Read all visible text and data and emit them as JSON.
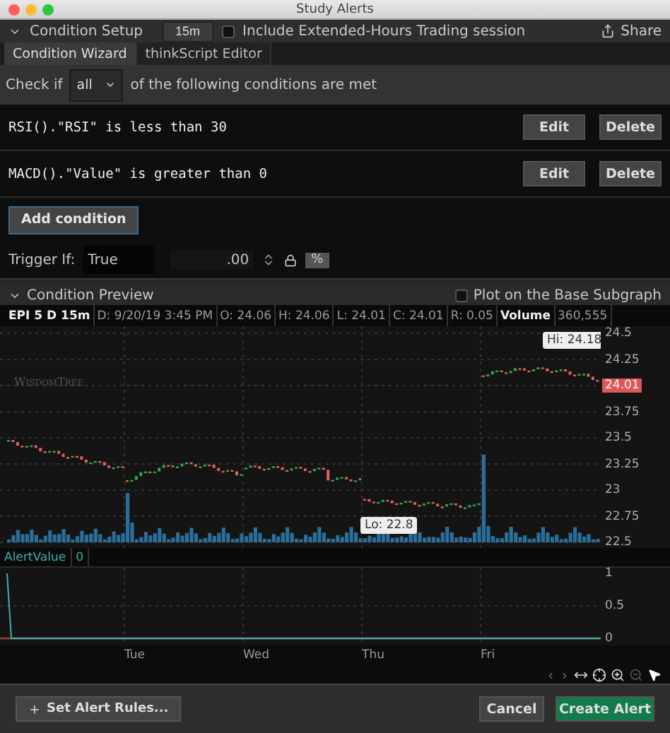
{
  "window": {
    "title": "Study Alerts"
  },
  "condition_setup": {
    "label": "Condition Setup",
    "expanded": true,
    "aggregation": "15m",
    "extended_hours": {
      "label": "Include Extended-Hours Trading session",
      "checked": false
    },
    "share": "Share"
  },
  "tabs": [
    {
      "label": "Condition Wizard",
      "selected": true
    },
    {
      "label": "thinkScript Editor",
      "selected": false
    }
  ],
  "check_if": {
    "prefix": "Check if",
    "value": "all",
    "suffix": "of the following conditions are met"
  },
  "conditions": [
    {
      "text": "RSI().\"RSI\" is less than 30",
      "edit": "Edit",
      "delete": "Delete"
    },
    {
      "text": "MACD().\"Value\" is greater than 0",
      "edit": "Edit",
      "delete": "Delete"
    }
  ],
  "add_condition": "Add condition",
  "trigger": {
    "label": "Trigger If:",
    "value": "True",
    "threshold": ".00",
    "unit": "%"
  },
  "preview": {
    "label": "Condition Preview",
    "expanded": true,
    "plot_on_base": {
      "label": "Plot on the Base Subgraph",
      "checked": false
    },
    "info": [
      "EPI 5 D 15m",
      "D: 9/20/19 3:45 PM",
      "O: 24.06",
      "H: 24.06",
      "L: 24.01",
      "C: 24.01",
      "R: 0.05",
      "Volume",
      "360,555"
    ],
    "watermark": "WisdomTree",
    "price_ticks": [
      {
        "label": "24.5",
        "kind": "tick"
      },
      {
        "label": "24.25",
        "kind": "tick"
      },
      {
        "label": "24.01",
        "kind": "last"
      },
      {
        "label": "23.75",
        "kind": "tick"
      },
      {
        "label": "23.5",
        "kind": "tick"
      },
      {
        "label": "23.25",
        "kind": "tick"
      },
      {
        "label": "23",
        "kind": "tick"
      },
      {
        "label": "22.75",
        "kind": "tick"
      },
      {
        "label": "22.5",
        "kind": "tick"
      }
    ],
    "hi": "Hi: 24.18",
    "lo": "Lo: 22.8",
    "study": {
      "name": "AlertValue",
      "value": "0",
      "ticks": [
        "1",
        "0.5",
        "0"
      ]
    },
    "days": [
      "Tue",
      "Wed",
      "Thu",
      "Fri"
    ]
  },
  "footer": {
    "set_rules": "Set Alert Rules...",
    "cancel": "Cancel",
    "create": "Create Alert"
  }
}
